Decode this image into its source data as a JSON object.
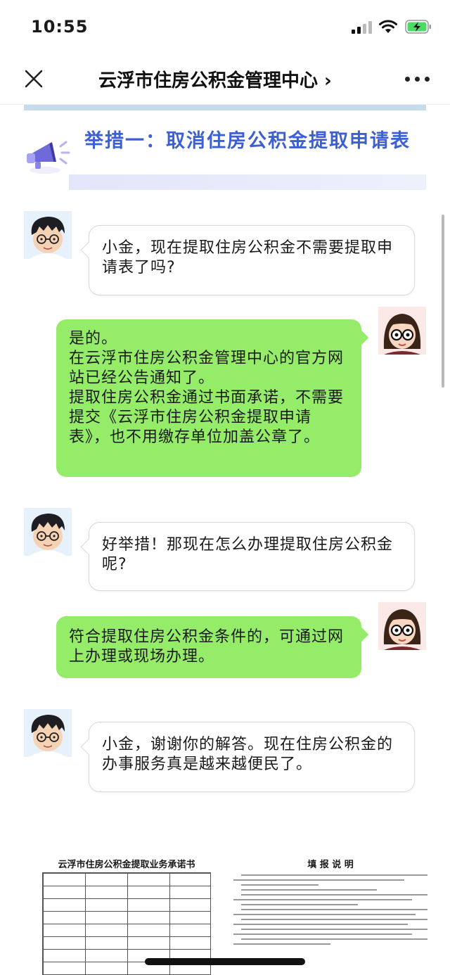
{
  "status_bar": {
    "time": "10:55"
  },
  "navbar": {
    "title": "云浮市住房公积金管理中心 ›"
  },
  "article": {
    "headline": "举措一：取消住房公积金提取申请表"
  },
  "colors": {
    "accent_blue": "#3c5fd4",
    "bubble_green": "#95ec69",
    "battery_green": "#4cd964"
  },
  "chat": {
    "m1": "小金，现在提取住房公积金不需要提取申请表了吗?",
    "m2": {
      "line1": "是的。",
      "line2": "在云浮市住房公积金管理中心的官方网站已经公告通知了。",
      "line3": "提取住房公积金通过书面承诺，不需要提交《云浮市住房公积金提取申请表》，也不用缴存单位加盖公章了。"
    },
    "m3": "好举措！那现在怎么办理提取住房公积金呢?",
    "m4": "符合提取住房公积金条件的，可通过网上办理或现场办理。",
    "m5": "小金，谢谢你的解答。现在住房公积金的办事服务真是越来越便民了。"
  },
  "documents": {
    "form_title": "云浮市住房公积金提取业务承诺书",
    "notes_title": "填 报 说 明"
  }
}
